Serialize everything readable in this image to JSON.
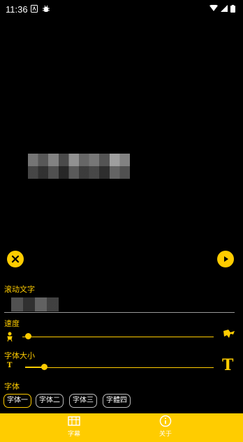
{
  "status_bar": {
    "time": "11:36",
    "icons": [
      "notification-a-icon",
      "bug-icon",
      "wifi-icon",
      "signal-icon",
      "battery-icon"
    ]
  },
  "controls": {
    "close_icon": "close-icon",
    "play_icon": "play-icon"
  },
  "settings": {
    "scroll_text_label": "滚动文字",
    "scroll_text_value": "",
    "speed_label": "速度",
    "speed_value_fraction": 0.03,
    "font_size_label": "字体大小",
    "font_size_value_fraction": 0.1,
    "font_label": "字体",
    "fonts": [
      {
        "label": "字体一",
        "selected": true
      },
      {
        "label": "字体二",
        "selected": false
      },
      {
        "label": "字体三",
        "selected": false
      },
      {
        "label": "字體四",
        "selected": false
      }
    ]
  },
  "bottom_nav": {
    "items": [
      {
        "label": "字幕",
        "icon": "subtitle-icon"
      },
      {
        "label": "关于",
        "icon": "info-icon"
      }
    ]
  },
  "colors": {
    "accent": "#ffcc00",
    "background": "#000000"
  }
}
